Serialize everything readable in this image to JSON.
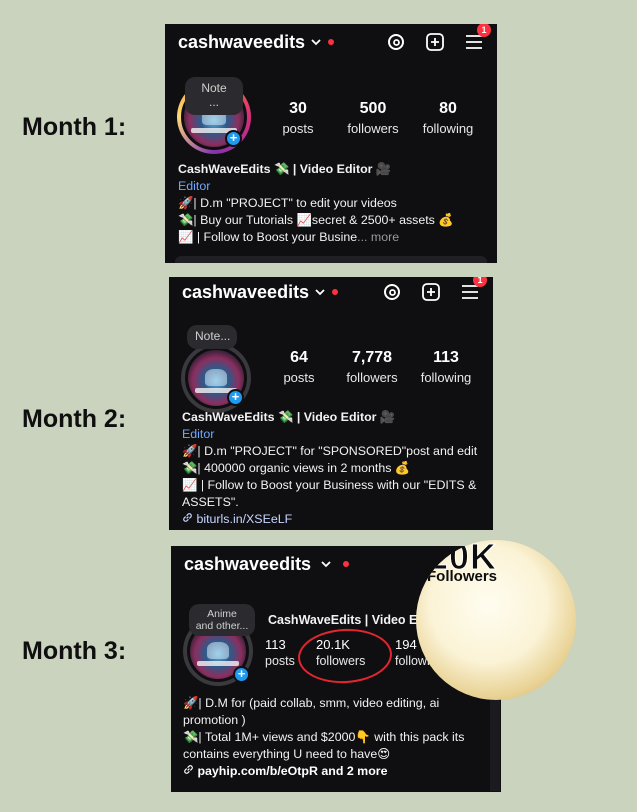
{
  "labels": {
    "m1": "Month 1:",
    "m2": "Month 2:",
    "m3": "Month 3:"
  },
  "m1": {
    "username": "cashwaveedits",
    "badge": "1",
    "note": "Note\n...",
    "stats": [
      {
        "num": "30",
        "label": "posts"
      },
      {
        "num": "500",
        "label": "followers"
      },
      {
        "num": "80",
        "label": "following"
      }
    ],
    "name": "CashWaveEdits 💸 | Video Editor 🎥",
    "category": "Editor",
    "bio1": "🚀| D.m \"PROJECT\" to edit your videos",
    "bio2": "💸|  Buy our Tutorials 📈secret & 2500+ assets 💰",
    "bio3": "📈 | Follow to Boost your Busine",
    "more": "... more"
  },
  "m2": {
    "username": "cashwaveedits",
    "badge": "1",
    "note": "Note...",
    "stats": [
      {
        "num": "64",
        "label": "posts"
      },
      {
        "num": "7,778",
        "label": "followers"
      },
      {
        "num": "113",
        "label": "following"
      }
    ],
    "name": "CashWaveEdits 💸 | Video Editor 🎥",
    "category": "Editor",
    "bio1": "🚀| D.m \"PROJECT\" for \"SPONSORED\"post and edit",
    "bio2": "💸| 400000 organic views in 2 months  💰",
    "bio3": "📈 | Follow to Boost your Business with our \"EDITS &",
    "bio4": "ASSETS\".",
    "link": "biturls.in/XSEeLF"
  },
  "m3": {
    "username": "cashwaveedits",
    "note": "Anime\nand other...",
    "title": "CashWaveEdits | Video Editor | SMM",
    "stats": [
      {
        "num": "113",
        "label": "posts"
      },
      {
        "num": "20.1K",
        "label": "followers"
      },
      {
        "num": "194",
        "label": "following"
      }
    ],
    "bio1": "🚀| D.M for (paid collab, smm, video editing, ai",
    "bio2": "promotion )",
    "bio3": "💸| Total 1M+ views and $2000👇 with this pack its",
    "bio4": "contains everything U need to have😍",
    "link": "payhip.com/b/eOtpR and 2 more",
    "milestone_big": "20K",
    "milestone_small": "Followers"
  },
  "colors": {
    "accent_red": "#ff3040",
    "link_blue": "#1d9bf0",
    "circle_red": "#e3262f"
  },
  "icons": [
    "chevron-down-icon",
    "threads-icon",
    "add-square-icon",
    "menu-icon",
    "link-icon",
    "plus-icon"
  ]
}
